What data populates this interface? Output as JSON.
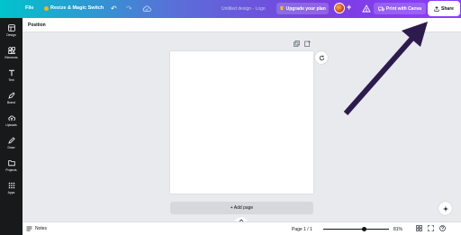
{
  "topbar": {
    "file_label": "File",
    "resize_label": "Resize & Magic Switch",
    "doc_title": "Untitled design - Logo",
    "upgrade_label": "Upgrade your plan",
    "print_label": "Print with Canva",
    "share_label": "Share",
    "gradient_colors": [
      "#00c4cc",
      "#7a3fe0",
      "#8b3dff"
    ]
  },
  "sidebar": {
    "items": [
      {
        "label": "Design",
        "icon": "design-icon"
      },
      {
        "label": "Elements",
        "icon": "elements-icon"
      },
      {
        "label": "Text",
        "icon": "text-icon"
      },
      {
        "label": "Brand",
        "icon": "brand-icon"
      },
      {
        "label": "Uploads",
        "icon": "uploads-icon"
      },
      {
        "label": "Draw",
        "icon": "draw-icon"
      },
      {
        "label": "Projects",
        "icon": "projects-icon"
      },
      {
        "label": "Apps",
        "icon": "apps-icon"
      }
    ]
  },
  "toolbar": {
    "position_label": "Position"
  },
  "canvas": {
    "add_page_label": "+ Add page"
  },
  "bottombar": {
    "notes_label": "Notes",
    "page_label": "Page 1 / 1",
    "zoom_label": "81%",
    "zoom_fraction": 0.62
  },
  "annotation": {
    "arrow_color": "#2d1b4e"
  }
}
